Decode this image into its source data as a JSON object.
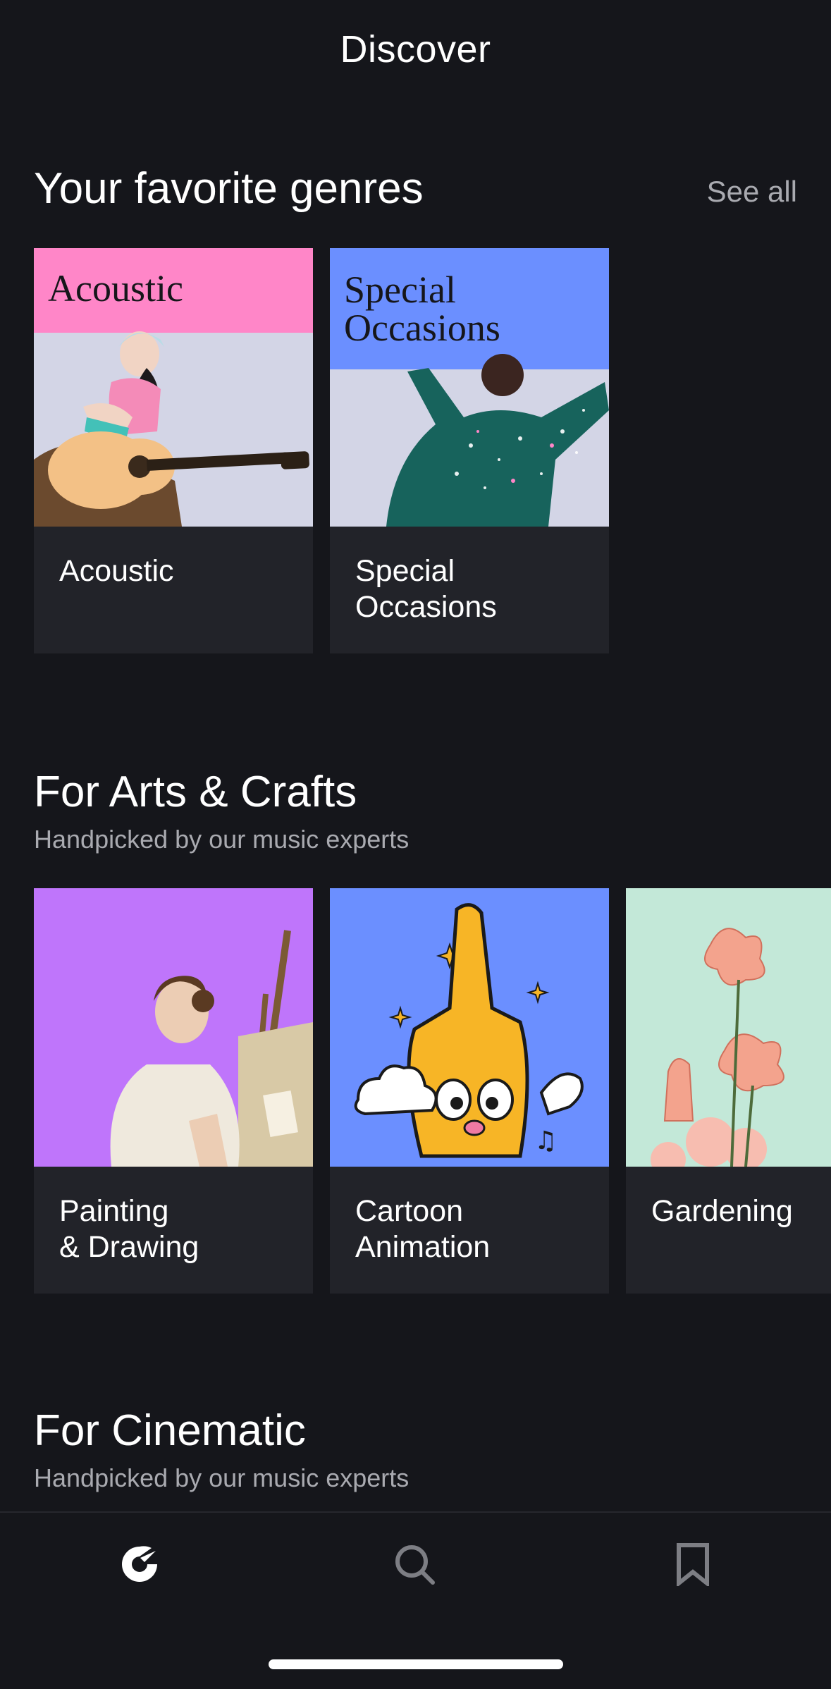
{
  "header": {
    "title": "Discover"
  },
  "sections": [
    {
      "title": "Your favorite genres",
      "see_all": "See all",
      "cards": [
        {
          "banner": "Acoustic",
          "label": "Acoustic"
        },
        {
          "banner": "Special\nOccasions",
          "label": "Special\nOccasions"
        }
      ]
    },
    {
      "title": "For Arts & Crafts",
      "subtitle": "Handpicked by our music experts",
      "cards": [
        {
          "label": "Painting\n& Drawing"
        },
        {
          "label": "Cartoon\nAnimation"
        },
        {
          "label": "Gardening"
        }
      ]
    },
    {
      "title": "For Cinematic",
      "subtitle": "Handpicked by our music experts"
    }
  ],
  "tabbar": {
    "tabs": [
      {
        "icon": "logo-icon",
        "active": true
      },
      {
        "icon": "search-icon",
        "active": false
      },
      {
        "icon": "bookmark-icon",
        "active": false
      }
    ]
  },
  "colors": {
    "background": "#15161b",
    "card": "#222329",
    "acoustic_banner": "#ff86c8",
    "occasions_banner": "#6b8fff",
    "painting_bg": "#bf75fb",
    "cartoon_bg": "#6b8fff",
    "gardening_bg": "#c3e8d8"
  }
}
